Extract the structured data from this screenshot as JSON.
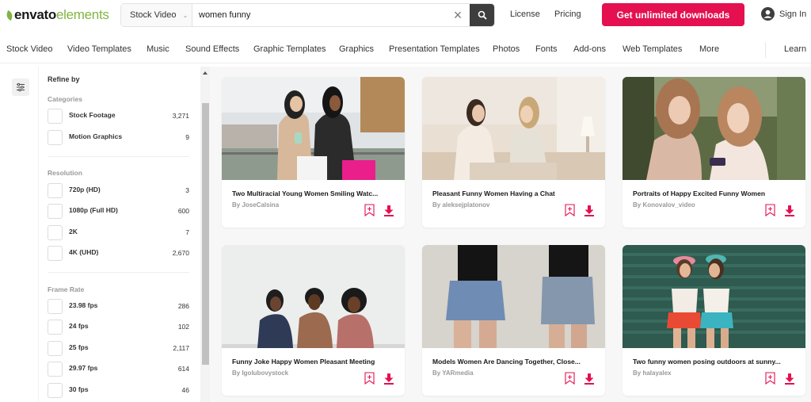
{
  "header": {
    "logo_bold": "envato",
    "logo_light": "elements",
    "search_category": "Stock Video",
    "search_query": "women funny",
    "links": [
      "License",
      "Pricing"
    ],
    "cta_label": "Get unlimited downloads",
    "signin_label": "Sign In"
  },
  "nav": {
    "items": [
      "Stock Video",
      "Video Templates",
      "Music",
      "Sound Effects",
      "Graphic Templates",
      "Graphics",
      "Presentation Templates",
      "Photos",
      "Fonts",
      "Add-ons",
      "Web Templates",
      "More"
    ],
    "learn": "Learn"
  },
  "filters": {
    "title": "Refine by",
    "groups": [
      {
        "title": "Categories",
        "options": [
          {
            "label": "Stock Footage",
            "count": "3,271"
          },
          {
            "label": "Motion Graphics",
            "count": "9"
          }
        ]
      },
      {
        "title": "Resolution",
        "options": [
          {
            "label": "720p (HD)",
            "count": "3"
          },
          {
            "label": "1080p (Full HD)",
            "count": "600"
          },
          {
            "label": "2K",
            "count": "7"
          },
          {
            "label": "4K (UHD)",
            "count": "2,670"
          }
        ]
      },
      {
        "title": "Frame Rate",
        "options": [
          {
            "label": "23.98 fps",
            "count": "286"
          },
          {
            "label": "24 fps",
            "count": "102"
          },
          {
            "label": "25 fps",
            "count": "2,117"
          },
          {
            "label": "29.97 fps",
            "count": "614"
          },
          {
            "label": "30 fps",
            "count": "46"
          }
        ]
      }
    ]
  },
  "results": [
    {
      "title": "Two Multiracial Young Women Smiling Watc...",
      "author": "By JoseCalsina"
    },
    {
      "title": "Pleasant Funny Women Having a Chat",
      "author": "By aleksejplatonov"
    },
    {
      "title": "Portraits of Happy Excited Funny Women",
      "author": "By Konovalov_video"
    },
    {
      "title": "Funny Joke Happy Women Pleasant Meeting",
      "author": "By Igolubovystock"
    },
    {
      "title": "Models Women Are Dancing Together, Close...",
      "author": "By YARmedia"
    },
    {
      "title": "Two funny women posing outdoors at sunny...",
      "author": "By halayalex"
    }
  ],
  "colors": {
    "accent": "#e4104f",
    "brand_green": "#82b541",
    "search_button": "#3d3d3d"
  }
}
